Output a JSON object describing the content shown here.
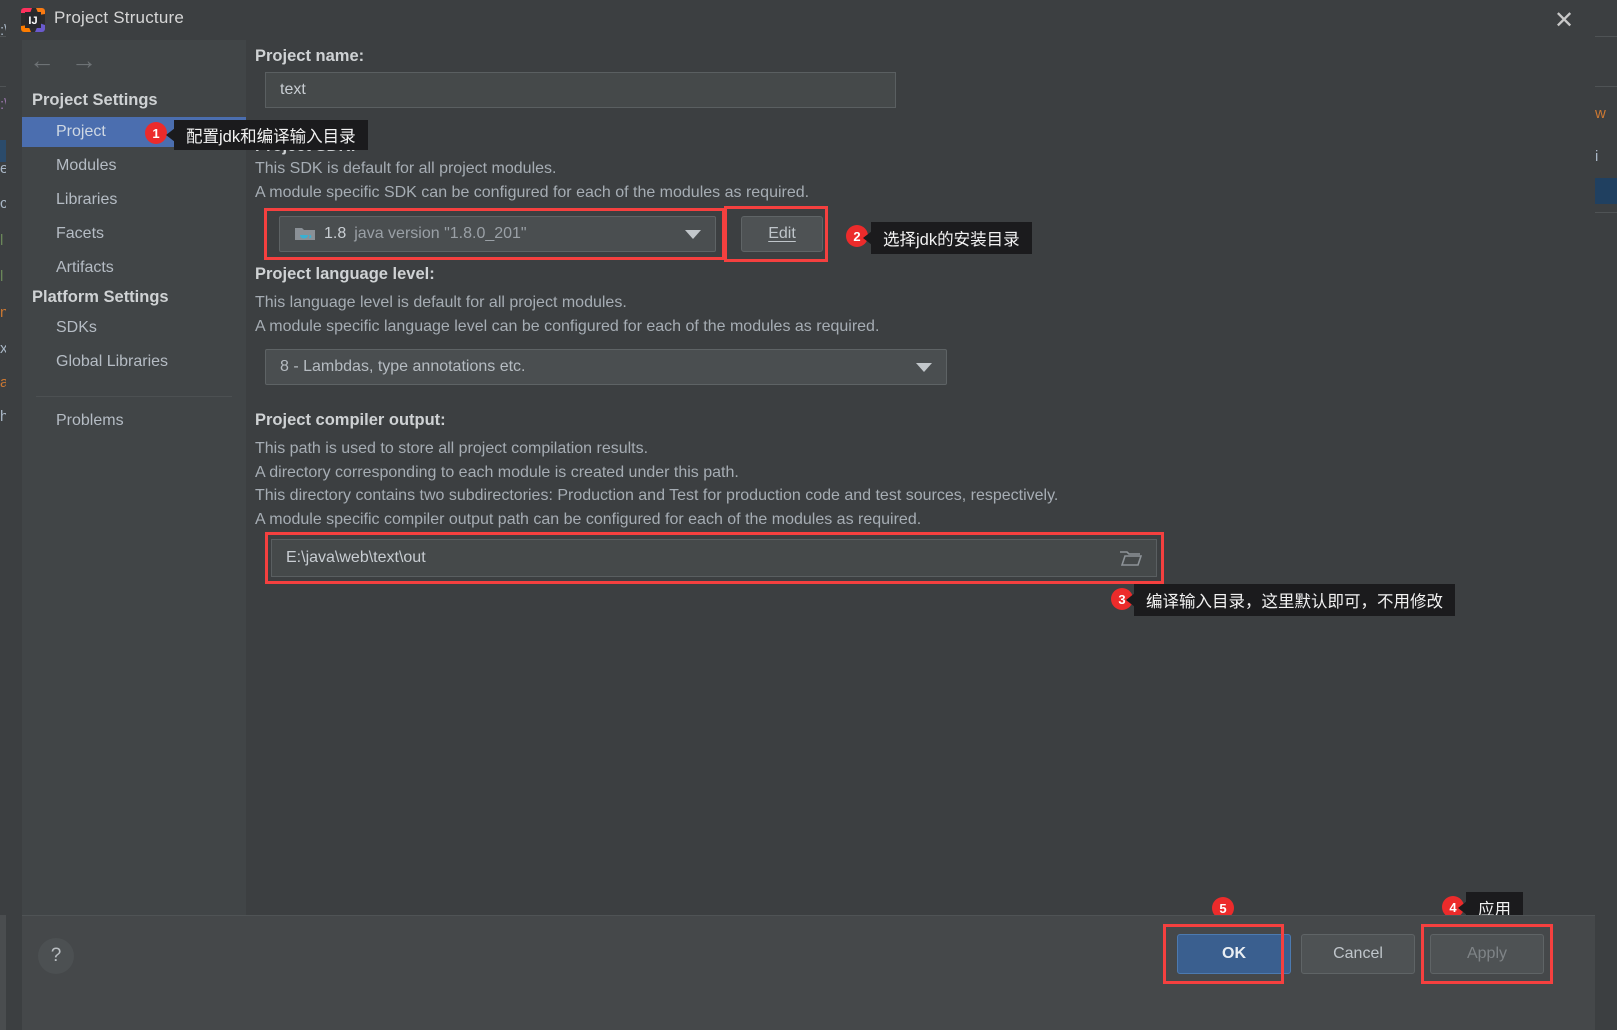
{
  "window": {
    "title": "Project Structure",
    "app_icon": "intellij-idea-icon",
    "close_label": "✕"
  },
  "nav": {
    "back_icon": "arrow-left-icon",
    "forward_icon": "arrow-right-icon",
    "back_glyph": "←",
    "forward_glyph": "→"
  },
  "sidebar": {
    "groups": [
      {
        "title": "Project Settings",
        "items": [
          {
            "label": "Project",
            "selected": true
          },
          {
            "label": "Modules",
            "selected": false
          },
          {
            "label": "Libraries",
            "selected": false
          },
          {
            "label": "Facets",
            "selected": false
          },
          {
            "label": "Artifacts",
            "selected": false
          }
        ]
      },
      {
        "title": "Platform Settings",
        "items": [
          {
            "label": "SDKs",
            "selected": false
          },
          {
            "label": "Global Libraries",
            "selected": false
          }
        ]
      }
    ],
    "extra": [
      {
        "label": "Problems",
        "selected": false
      }
    ]
  },
  "main": {
    "project_name": {
      "label": "Project name:",
      "value": "text"
    },
    "project_sdk": {
      "label": "Project SDK:",
      "desc_line1": "This SDK is default for all project modules.",
      "desc_line2": "A module specific SDK can be configured for each of the modules as required.",
      "sdk_version": "1.8",
      "sdk_detail": "java version \"1.8.0_201\"",
      "sdk_icon": "java-folder-icon",
      "edit_button": "Edit"
    },
    "language_level": {
      "label": "Project language level:",
      "desc_line1": "This language level is default for all project modules.",
      "desc_line2": "A module specific language level can be configured for each of the modules as required.",
      "value": "8 - Lambdas, type annotations etc."
    },
    "compiler_output": {
      "label": "Project compiler output:",
      "desc_line1": "This path is used to store all project compilation results.",
      "desc_line2": "A directory corresponding to each module is created under this path.",
      "desc_line3": "This directory contains two subdirectories: Production and Test for production code and test sources, respectively.",
      "desc_line4": "A module specific compiler output path can be configured for each of the modules as required.",
      "value": "E:\\java\\web\\text\\out",
      "browse_icon": "folder-browse-icon"
    }
  },
  "annotations": [
    {
      "number": "1",
      "text": "配置jdk和编译输入目录"
    },
    {
      "number": "2",
      "text": "选择jdk的安装目录"
    },
    {
      "number": "3",
      "text": "编译输入目录，这里默认即可，不用修改"
    },
    {
      "number": "4",
      "text": "应用"
    },
    {
      "number": "5",
      "text": ""
    }
  ],
  "footer": {
    "help_icon": "question-mark-icon",
    "help_label": "?",
    "buttons": [
      {
        "label": "OK",
        "style": "primary"
      },
      {
        "label": "Cancel",
        "style": "normal"
      },
      {
        "label": "Apply",
        "style": "disabled"
      }
    ]
  },
  "colors": {
    "accent_red": "#ec2b2b",
    "highlight_blue": "#4b6eaf",
    "primary_button": "#3a5f8f",
    "dialog_bg": "#3c3f41",
    "sidebar_bg": "#414547"
  },
  "background_ide": {
    "left_fragments": [
      ":\\",
      "e",
      "c",
      "l",
      "l",
      "n",
      "xt",
      "a",
      "h"
    ],
    "right_fragments": [
      "w",
      "i"
    ]
  }
}
